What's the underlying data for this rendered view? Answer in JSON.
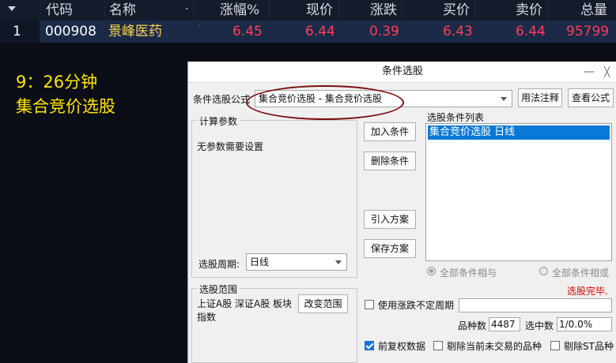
{
  "table": {
    "headers": {
      "code": "代码",
      "name": "名称",
      "dot": "·",
      "change_pct": "涨幅%",
      "price": "现价",
      "change": "涨跌",
      "bid": "买价",
      "ask": "卖价",
      "volume": "总量"
    },
    "row": {
      "index": "1",
      "code": "000908",
      "name": "景峰医药",
      "change_pct": "6.45",
      "price": "6.44",
      "change": "0.39",
      "bid": "6.43",
      "ask": "6.44",
      "volume": "95799"
    }
  },
  "annotation": {
    "time": "9：26分钟",
    "title": "集合竞价选股"
  },
  "dialog": {
    "title": "条件选股",
    "minimize": "—",
    "close": "╳",
    "formula_label": "条件选股公式",
    "formula_value": "集合竞价选股 - 集合竞价选股",
    "usage_button": "用法注释",
    "view_formula_button": "查看公式",
    "params_group": "计算参数",
    "params_text": "无参数需要设置",
    "period_label": "选股周期:",
    "period_value": "日线",
    "add_condition": "加入条件",
    "delete_condition": "删除条件",
    "import_plan": "引入方案",
    "save_plan": "保存方案",
    "condition_list_label": "选股条件列表",
    "condition_items": [
      "集合竞价选股  日线"
    ],
    "radio_and": "全部条件相与",
    "radio_or": "全部条件相或",
    "status": "选股完毕.",
    "range_group": "选股范围",
    "range_text": "上证A股 深证A股 板块指数",
    "change_range_button": "改变范围",
    "use_period_label": "使用涨跌不定周期",
    "count_label": "品种数",
    "count_value": "4487",
    "selected_label": "选中数",
    "selected_value": "1/0.0%",
    "pre_adjust_label": "前复权数据",
    "exclude_untraded_label": "剔除当前未交易的品种",
    "exclude_st_label": "剔除ST品种"
  },
  "colors": {
    "up_red": "#ff3d5a",
    "code_white": "#ffffff",
    "name_yellow": "#ffd54a",
    "annotation_yellow": "#ffe600",
    "highlight_ellipse": "#7b1010",
    "list_selection": "#0a78d7",
    "status_red": "#e00000"
  }
}
